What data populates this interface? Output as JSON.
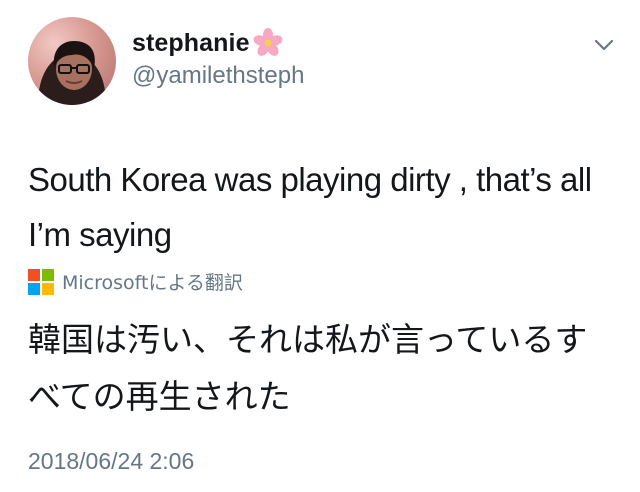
{
  "user": {
    "display_name": "stephanie",
    "name_emoji": "cherry-blossom-icon",
    "handle": "@yamilethsteph"
  },
  "tweet": {
    "text": "South Korea was playing dirty , that’s all I’m saying",
    "translation_label": "Microsoftによる翻訳",
    "translation_provider_icon": "microsoft-logo-icon",
    "translated_text": "韓国は汚い、それは私が言っているすべての再生された",
    "timestamp": "2018/06/24 2:06"
  },
  "menu": {
    "icon": "chevron-down-icon"
  },
  "colors": {
    "text_primary": "#14171a",
    "text_secondary": "#657786",
    "ms_red": "#f25022",
    "ms_green": "#7fba00",
    "ms_blue": "#00a4ef",
    "ms_yellow": "#ffb900"
  }
}
